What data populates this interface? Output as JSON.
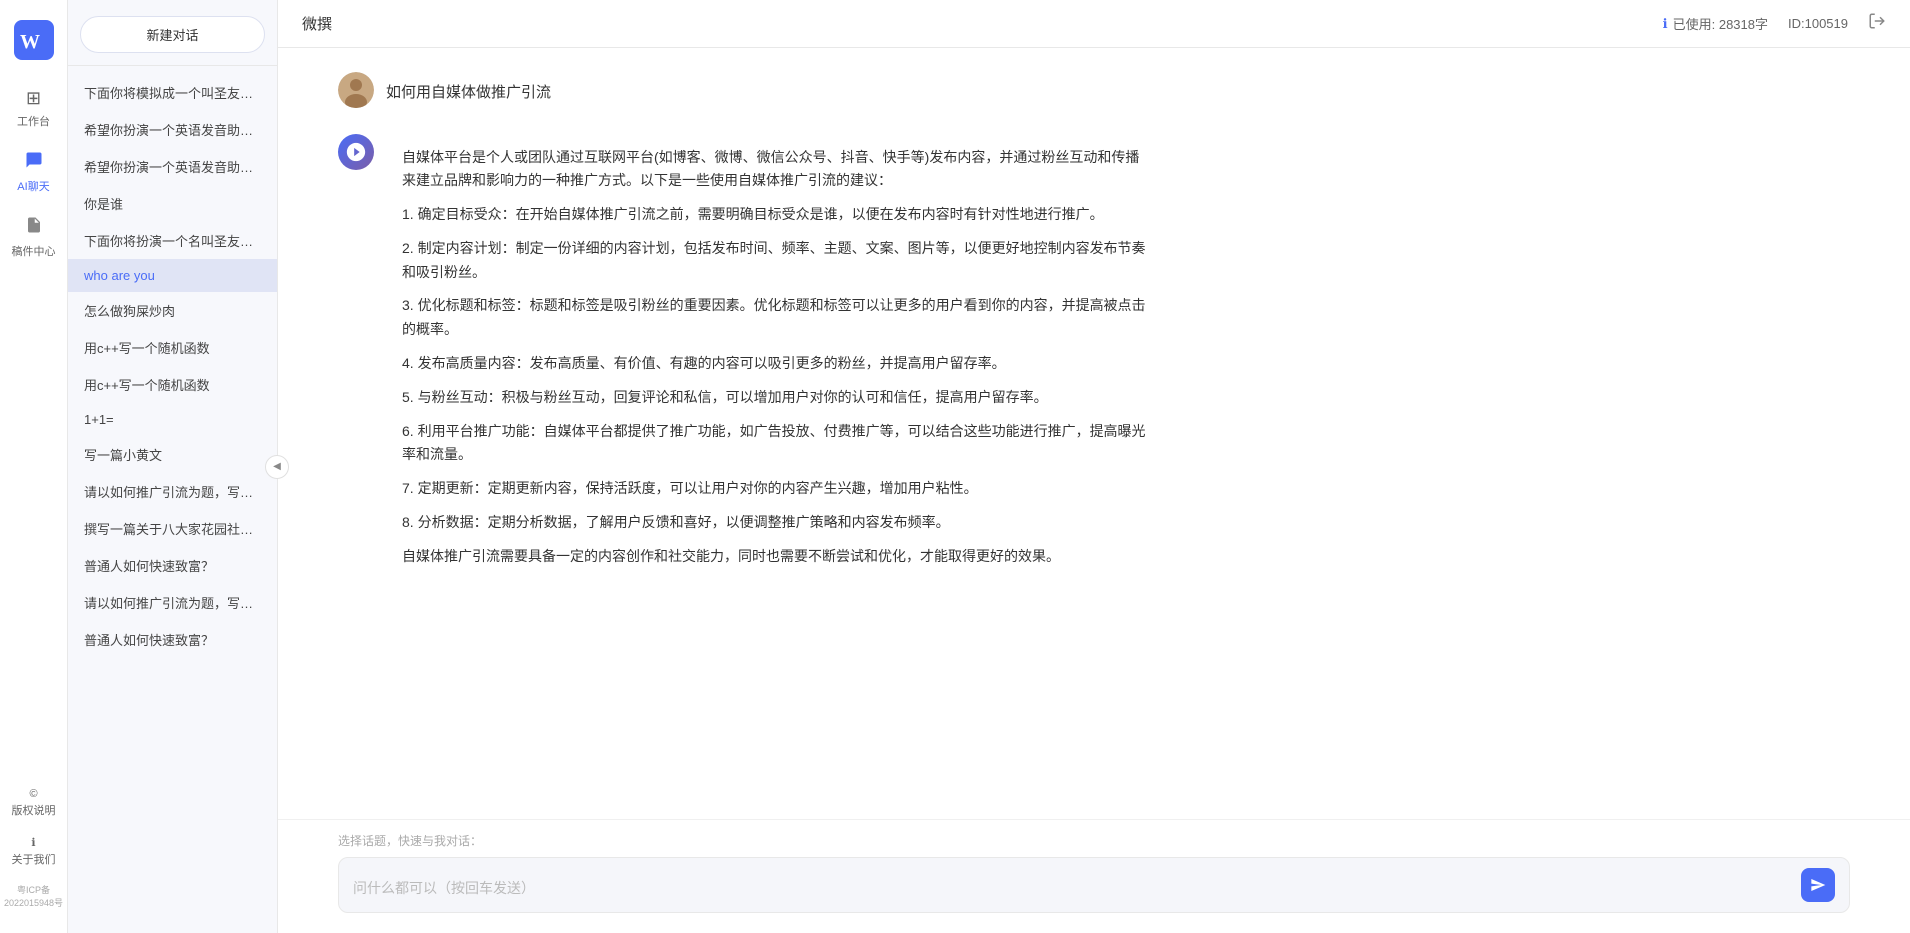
{
  "app": {
    "title": "微撰",
    "logo_text": "W"
  },
  "topbar": {
    "title": "微撰",
    "usage_label": "已使用: 28318字",
    "id_label": "ID:100519",
    "usage_icon": "info-icon",
    "logout_icon": "logout-icon"
  },
  "nav": {
    "items": [
      {
        "id": "workbench",
        "label": "工作台",
        "icon": "⊞"
      },
      {
        "id": "ai-chat",
        "label": "AI聊天",
        "icon": "💬",
        "active": true
      },
      {
        "id": "drafts",
        "label": "稿件中心",
        "icon": "📄"
      }
    ],
    "bottom_items": [
      {
        "id": "copyright",
        "label": "版权说明",
        "icon": "©"
      },
      {
        "id": "about",
        "label": "关于我们",
        "icon": "ℹ"
      }
    ],
    "icp": "粤ICP备2022015948号"
  },
  "sidebar": {
    "new_chat_label": "新建对话",
    "chat_list": [
      {
        "id": 1,
        "text": "下面你将模拟成一个叫圣友的程序员，我说..."
      },
      {
        "id": 2,
        "text": "希望你扮演一个英语发音助手，我提供给你..."
      },
      {
        "id": 3,
        "text": "希望你扮演一个英语发音助手，我提供给你..."
      },
      {
        "id": 4,
        "text": "你是谁"
      },
      {
        "id": 5,
        "text": "下面你将扮演一个名叫圣友的医生"
      },
      {
        "id": 6,
        "text": "who are you",
        "active": true
      },
      {
        "id": 7,
        "text": "怎么做狗屎炒肉"
      },
      {
        "id": 8,
        "text": "用c++写一个随机函数"
      },
      {
        "id": 9,
        "text": "用c++写一个随机函数"
      },
      {
        "id": 10,
        "text": "1+1="
      },
      {
        "id": 11,
        "text": "写一篇小黄文"
      },
      {
        "id": 12,
        "text": "请以如何推广引流为题，写一篇大纲"
      },
      {
        "id": 13,
        "text": "撰写一篇关于八大家花园社区一刻钟便民生..."
      },
      {
        "id": 14,
        "text": "普通人如何快速致富？"
      },
      {
        "id": 15,
        "text": "请以如何推广引流为题，写一篇大纲"
      },
      {
        "id": 16,
        "text": "普通人如何快速致富？"
      }
    ],
    "toggle_icon": "◀"
  },
  "chat": {
    "user_question": "如何用自媒体做推广引流",
    "ai_response": {
      "paragraphs": [
        "自媒体平台是个人或团队通过互联网平台(如博客、微博、微信公众号、抖音、快手等)发布内容，并通过粉丝互动和传播来建立品牌和影响力的一种推广方式。以下是一些使用自媒体推广引流的建议：",
        "1. 确定目标受众：在开始自媒体推广引流之前，需要明确目标受众是谁，以便在发布内容时有针对性地进行推广。",
        "2. 制定内容计划：制定一份详细的内容计划，包括发布时间、频率、主题、文案、图片等，以便更好地控制内容发布节奏和吸引粉丝。",
        "3. 优化标题和标签：标题和标签是吸引粉丝的重要因素。优化标题和标签可以让更多的用户看到你的内容，并提高被点击的概率。",
        "4. 发布高质量内容：发布高质量、有价值、有趣的内容可以吸引更多的粉丝，并提高用户留存率。",
        "5. 与粉丝互动：积极与粉丝互动，回复评论和私信，可以增加用户对你的认可和信任，提高用户留存率。",
        "6. 利用平台推广功能：自媒体平台都提供了推广功能，如广告投放、付费推广等，可以结合这些功能进行推广，提高曝光率和流量。",
        "7. 定期更新：定期更新内容，保持活跃度，可以让用户对你的内容产生兴趣，增加用户粘性。",
        "8. 分析数据：定期分析数据，了解用户反馈和喜好，以便调整推广策略和内容发布频率。",
        "自媒体推广引流需要具备一定的内容创作和社交能力，同时也需要不断尝试和优化，才能取得更好的效果。"
      ]
    }
  },
  "input": {
    "quick_topics_label": "选择话题，快速与我对话：",
    "placeholder": "问什么都可以（按回车发送）",
    "send_icon": "send-icon"
  }
}
